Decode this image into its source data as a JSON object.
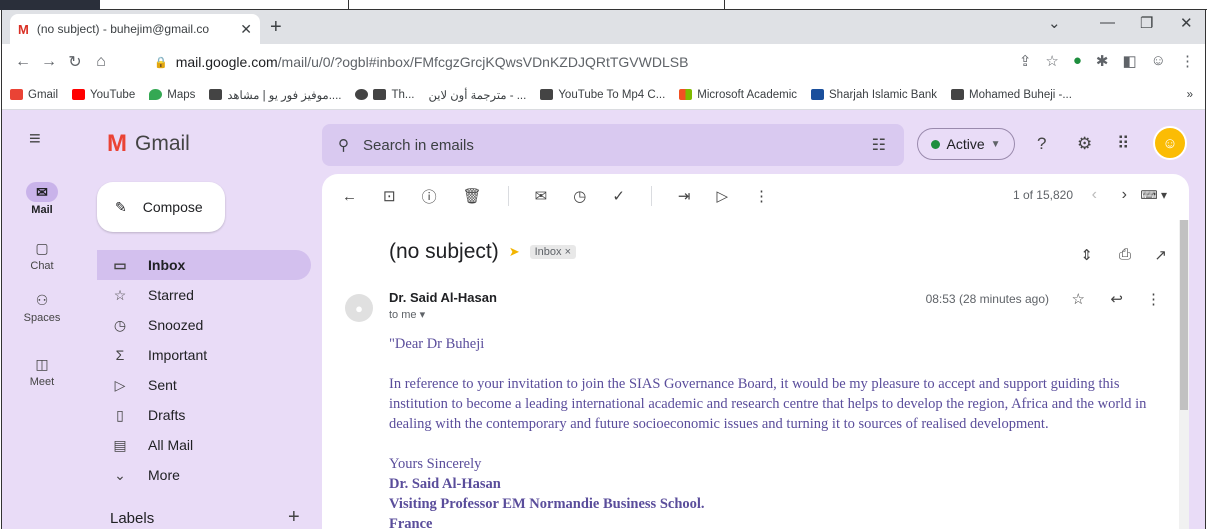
{
  "browser": {
    "tab_title": "(no subject) - buhejim@gmail.co",
    "tab_close": "✕",
    "new_tab": "+",
    "url_host": "mail.google.com",
    "url_path": "/mail/u/0/?ogbl#inbox/FMfcgzGrcjKQwsVDnKZDJQRtTGVWDLSB",
    "bookmarks": [
      {
        "label": "Gmail",
        "color": "#ea4335"
      },
      {
        "label": "YouTube",
        "color": "#ff0000"
      },
      {
        "label": "Maps",
        "color": "#34a853"
      },
      {
        "label": "موفيز فور يو | مشاهد....",
        "color": "#444444"
      },
      {
        "label": "Th...",
        "color": "#444444"
      },
      {
        "label": "مترجمة أون لاين - ...",
        "color": "#444444"
      },
      {
        "label": "YouTube To Mp4 C...",
        "color": "#444444"
      },
      {
        "label": "Microsoft Academic",
        "color": "#f25022"
      },
      {
        "label": "Sharjah Islamic Bank",
        "color": "#1a4f9c"
      },
      {
        "label": "Mohamed Buheji -...",
        "color": "#444444"
      }
    ],
    "bookmarks_more": "»"
  },
  "gmail": {
    "logo_text": "Gmail",
    "compose_label": "Compose",
    "search_placeholder": "Search in emails",
    "status_label": "Active",
    "rail": [
      {
        "label": "Mail",
        "icon": "mail-icon",
        "glyph": "✉"
      },
      {
        "label": "Chat",
        "icon": "chat-icon",
        "glyph": "▢"
      },
      {
        "label": "Spaces",
        "icon": "spaces-icon",
        "glyph": "⚇"
      },
      {
        "label": "Meet",
        "icon": "meet-icon",
        "glyph": "◫"
      }
    ],
    "nav": [
      {
        "label": "Inbox",
        "glyph": "▭"
      },
      {
        "label": "Starred",
        "glyph": "☆"
      },
      {
        "label": "Snoozed",
        "glyph": "◷"
      },
      {
        "label": "Important",
        "glyph": "Σ"
      },
      {
        "label": "Sent",
        "glyph": "▷"
      },
      {
        "label": "Drafts",
        "glyph": "▯"
      },
      {
        "label": "All Mail",
        "glyph": "▤"
      },
      {
        "label": "More",
        "glyph": "⌄"
      }
    ],
    "labels_heading": "Labels",
    "labels_add": "+",
    "count_text": "1 of 15,820"
  },
  "message": {
    "subject": "(no subject)",
    "inbox_tag": "Inbox ×",
    "sender_name": "Dr. Said Al-Hasan",
    "to_line": "to me ▾",
    "time": "08:53 (28 minutes ago)",
    "greeting": "\"Dear Dr Buheji",
    "paragraph": "In reference to your invitation to join the SIAS Governance Board, it would be my pleasure to accept and support guiding this institution to become a leading international academic and research centre that helps to develop the region, Africa and the world in dealing with the contemporary and future socioeconomic issues and turning it to sources of realised development.",
    "closing": "Yours Sincerely",
    "signature_name": "Dr. Said Al-Hasan",
    "signature_title": "Visiting Professor EM Normandie Business School.",
    "signature_country": "France"
  }
}
